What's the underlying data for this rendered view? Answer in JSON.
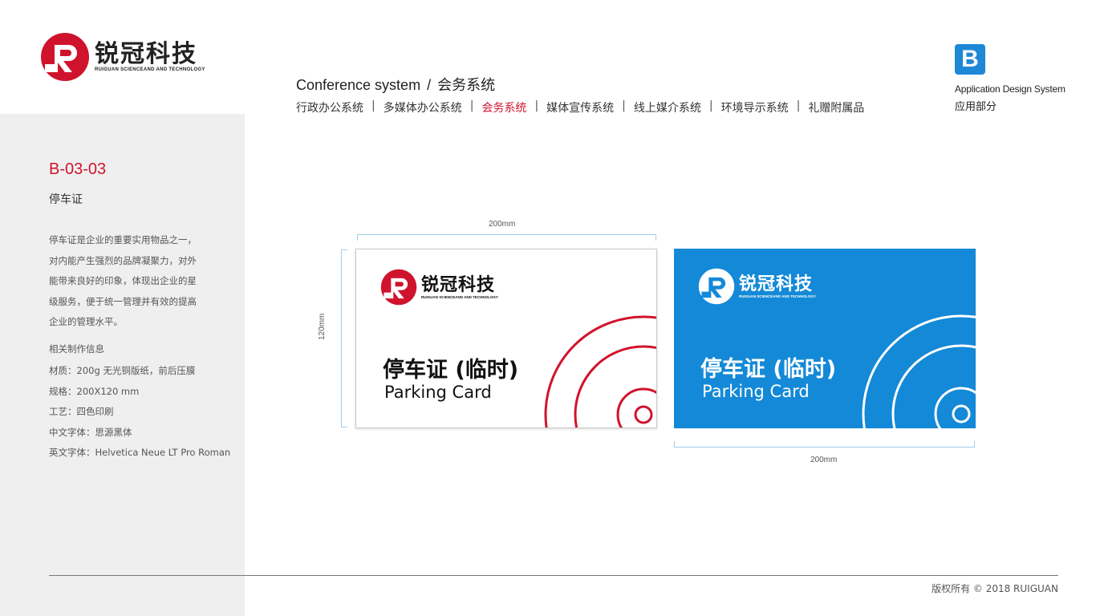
{
  "brand": {
    "name_cn": "锐冠科技",
    "name_en": "RUIGUAN SCIENCEAND AND TECHNOLOGY",
    "accent": "#d0132c",
    "blue": "#1489d7"
  },
  "header": {
    "title_en": "Conference system",
    "separator": "/",
    "title_cn": "会务系统",
    "nav": [
      {
        "label": "行政办公系统",
        "active": false
      },
      {
        "label": "多媒体办公系统",
        "active": false
      },
      {
        "label": "会务系统",
        "active": true
      },
      {
        "label": "媒体宣传系统",
        "active": false
      },
      {
        "label": "线上媒介系统",
        "active": false
      },
      {
        "label": "环境导示系统",
        "active": false
      },
      {
        "label": "礼赠附属品",
        "active": false
      }
    ],
    "nav_separator": "|"
  },
  "section_badge": {
    "letter": "B",
    "label_en": "Application Design System",
    "label_cn": "应用部分"
  },
  "sidebar": {
    "code": "B-03-03",
    "title": "停车证",
    "description_lines": [
      "停车证是企业的重要实用物品之一，",
      "对内能产生强烈的品牌凝聚力，对外",
      "能带来良好的印象，体现出企业的星",
      "级服务，便于统一管理并有效的提高",
      "企业的管理水平。"
    ],
    "spec_heading": "相关制作信息",
    "specs": [
      "材质：200g 无光铜版纸，前后压膜",
      "规格：200X120 mm",
      "工艺：四色印刷",
      "中文字体：思源黑体",
      "英文字体：Helvetica Neue LT Pro Roman"
    ]
  },
  "dimensions": {
    "top_width": "200mm",
    "left_height": "120mm",
    "bottom_width": "200mm"
  },
  "cards": [
    {
      "variant": "white",
      "title_cn": "停车证 (临时)",
      "title_en": "Parking Card"
    },
    {
      "variant": "blue",
      "title_cn": "停车证 (临时)",
      "title_en": "Parking Card"
    }
  ],
  "footer": {
    "copyright": "版权所有 ©   2018   RUIGUAN"
  }
}
